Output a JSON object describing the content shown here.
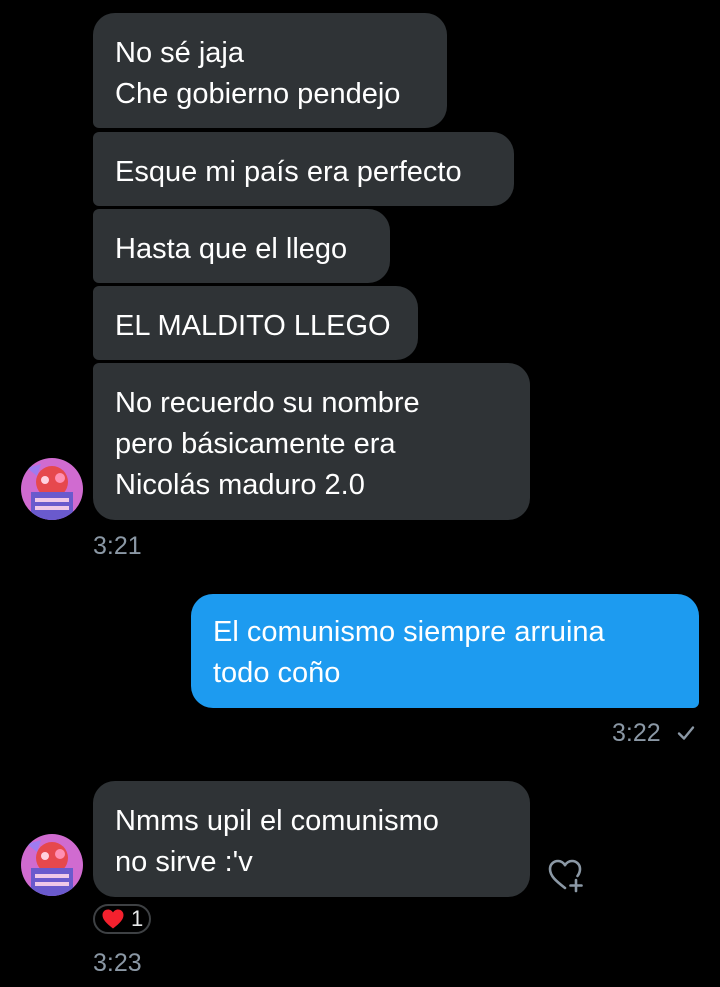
{
  "messages_in_1": [
    "No sé jaja\nChe gobierno pendejo",
    "Esque mi país era perfecto",
    "Hasta que el llego",
    "EL MALDITO LLEGO",
    "No recuerdo su nombre\npero básicamente era\nNicolás maduro 2.0"
  ],
  "time_1": "3:21",
  "message_out": "El comunismo siempre arruina\ntodo coño",
  "time_2": "3:22",
  "message_in_2": "Nmms upil el comunismo\nno sirve :'v",
  "reaction": {
    "icon": "heart-icon",
    "count": "1",
    "color": "#f4212e"
  },
  "time_3": "3:23",
  "colors": {
    "incoming_bubble": "#2f3336",
    "outgoing_bubble": "#1d9bf0",
    "timestamp": "#8b98a5"
  }
}
